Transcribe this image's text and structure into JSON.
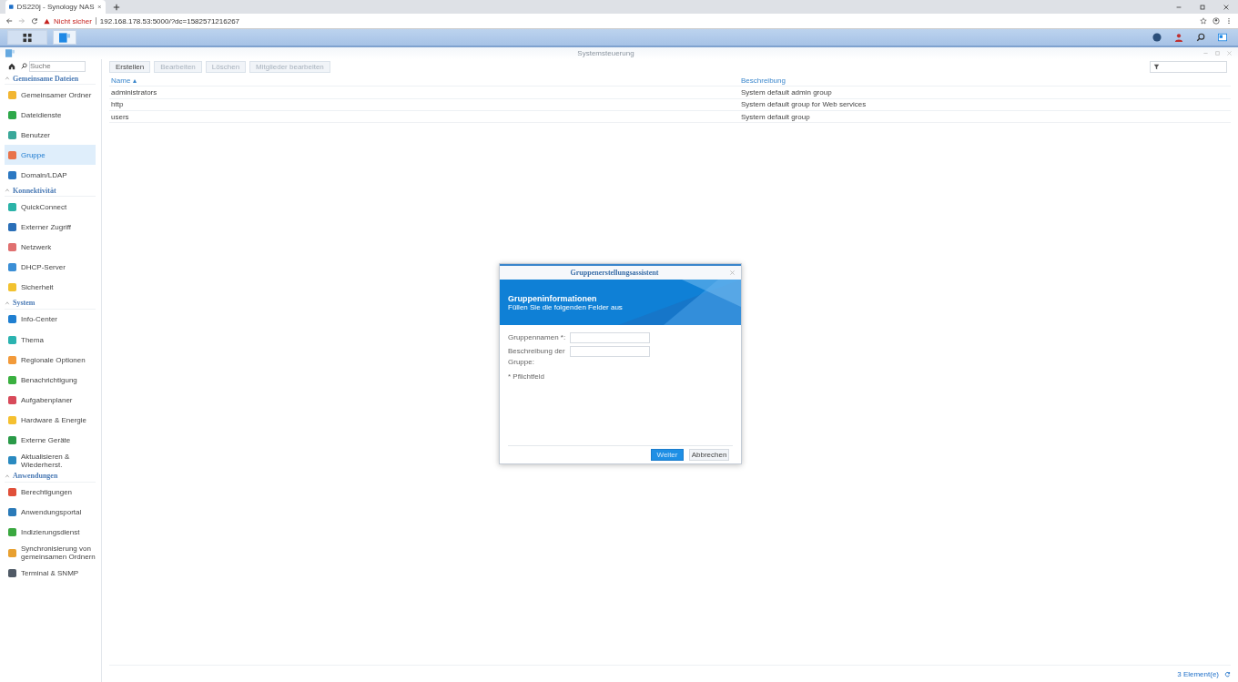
{
  "browser": {
    "tab_title": "DS220j - Synology NAS",
    "warning": "Nicht sicher",
    "url": "192.168.178.53:5000/?dc=1582571216267"
  },
  "window": {
    "title": "Systemsteuerung"
  },
  "sidebar": {
    "search": {
      "placeholder": "Suche"
    },
    "sections": [
      {
        "title": "Gemeinsame Dateien",
        "expanded": true,
        "items": [
          {
            "label": "Gemeinsamer Ordner",
            "color": "#f2b632",
            "selected": false
          },
          {
            "label": "Dateidienste",
            "color": "#2ea84a",
            "selected": false
          },
          {
            "label": "Benutzer",
            "color": "#3aa89a",
            "selected": false
          },
          {
            "label": "Gruppe",
            "color": "#e8734a",
            "selected": true
          },
          {
            "label": "Domain/LDAP",
            "color": "#2b78c2",
            "selected": false
          }
        ]
      },
      {
        "title": "Konnektivität",
        "expanded": true,
        "items": [
          {
            "label": "QuickConnect",
            "color": "#2bb3a8",
            "selected": false
          },
          {
            "label": "Externer Zugriff",
            "color": "#2a6fb8",
            "selected": false
          },
          {
            "label": "Netzwerk",
            "color": "#e07070",
            "selected": false
          },
          {
            "label": "DHCP-Server",
            "color": "#3b8fd6",
            "selected": false
          },
          {
            "label": "Sicherheit",
            "color": "#f2c230",
            "selected": false
          }
        ]
      },
      {
        "title": "System",
        "expanded": true,
        "items": [
          {
            "label": "Info-Center",
            "color": "#1f7fd1",
            "selected": false
          },
          {
            "label": "Thema",
            "color": "#2bb3b0",
            "selected": false
          },
          {
            "label": "Regionale Optionen",
            "color": "#f29a3a",
            "selected": false
          },
          {
            "label": "Benachrichtigung",
            "color": "#3ab040",
            "selected": false
          },
          {
            "label": "Aufgabenplaner",
            "color": "#d84a5a",
            "selected": false
          },
          {
            "label": "Hardware & Energie",
            "color": "#f5c030",
            "selected": false
          },
          {
            "label": "Externe Geräte",
            "color": "#2a9a48",
            "selected": false
          },
          {
            "label": "Aktualisieren & Wiederherst.",
            "color": "#2a8ac0",
            "selected": false
          }
        ]
      },
      {
        "title": "Anwendungen",
        "expanded": true,
        "items": [
          {
            "label": "Berechtigungen",
            "color": "#e0503a",
            "selected": false
          },
          {
            "label": "Anwendungsportal",
            "color": "#2a7ab8",
            "selected": false
          },
          {
            "label": "Indizierungsdienst",
            "color": "#3aa840",
            "selected": false
          },
          {
            "label": "Synchronisierung von gemeinsamen Ordnern",
            "color": "#e8a030",
            "selected": false
          },
          {
            "label": "Terminal & SNMP",
            "color": "#505a66",
            "selected": false
          }
        ]
      }
    ]
  },
  "toolbar": {
    "buttons": [
      {
        "label": "Erstellen",
        "disabled": false
      },
      {
        "label": "Bearbeiten",
        "disabled": true
      },
      {
        "label": "Löschen",
        "disabled": true
      },
      {
        "label": "Mitglieder bearbeiten",
        "disabled": true
      }
    ]
  },
  "table": {
    "columns": [
      {
        "label": "Name",
        "sort": "▴"
      },
      {
        "label": "Beschreibung"
      }
    ],
    "rows": [
      [
        "administrators",
        "System default admin group"
      ],
      [
        "http",
        "System default group for Web services"
      ],
      [
        "users",
        "System default group"
      ]
    ]
  },
  "status_bar": {
    "count": "3 Element(e)"
  },
  "dialog": {
    "title": "Gruppenerstellungsassistent",
    "heading": "Gruppeninformationen",
    "subheading": "Füllen Sie die folgenden Felder aus",
    "fields": [
      {
        "label": "Gruppennamen *:"
      },
      {
        "label": "Beschreibung der Gruppe:"
      }
    ],
    "note": "* Pflichtfeld",
    "buttons": [
      {
        "label": "Weiter",
        "primary": true
      },
      {
        "label": "Abbrechen",
        "primary": false
      }
    ]
  }
}
